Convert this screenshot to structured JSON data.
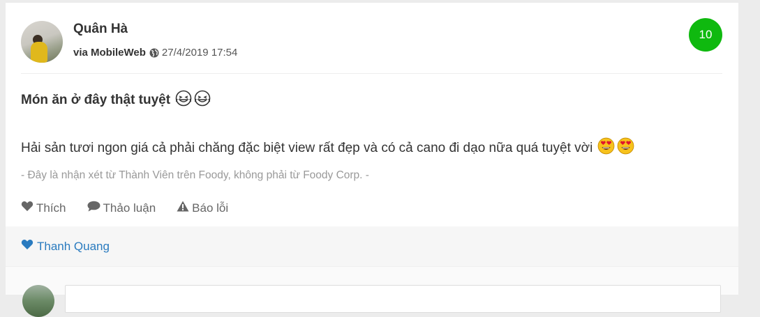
{
  "review": {
    "author": "Quân Hà",
    "via": "via MobileWeb",
    "datetime": "27/4/2019 17:54",
    "score": "10",
    "title": "Món ăn ở đây thật tuyệt",
    "body": "Hải sản tươi ngon giá cả phải chăng đặc biệt view rất đẹp và có cả cano đi dạo nữa quá tuyệt vời",
    "disclaimer": "- Đây là nhận xét từ Thành Viên trên Foody, không phải từ Foody Corp. -",
    "score_color": "#0fb90f"
  },
  "actions": {
    "like": "Thích",
    "discuss": "Thảo luận",
    "report": "Báo lỗi"
  },
  "likes": {
    "liker_name": "Thanh Quang",
    "accent": "#2a7bbf"
  },
  "icons": {
    "globe": "globe-icon",
    "like": "heart-icon",
    "discuss": "comment-icon",
    "report": "warning-icon",
    "title_emoji": "grinning-squint-tears-emoji",
    "body_emoji": "heart-eyes-emoji"
  }
}
